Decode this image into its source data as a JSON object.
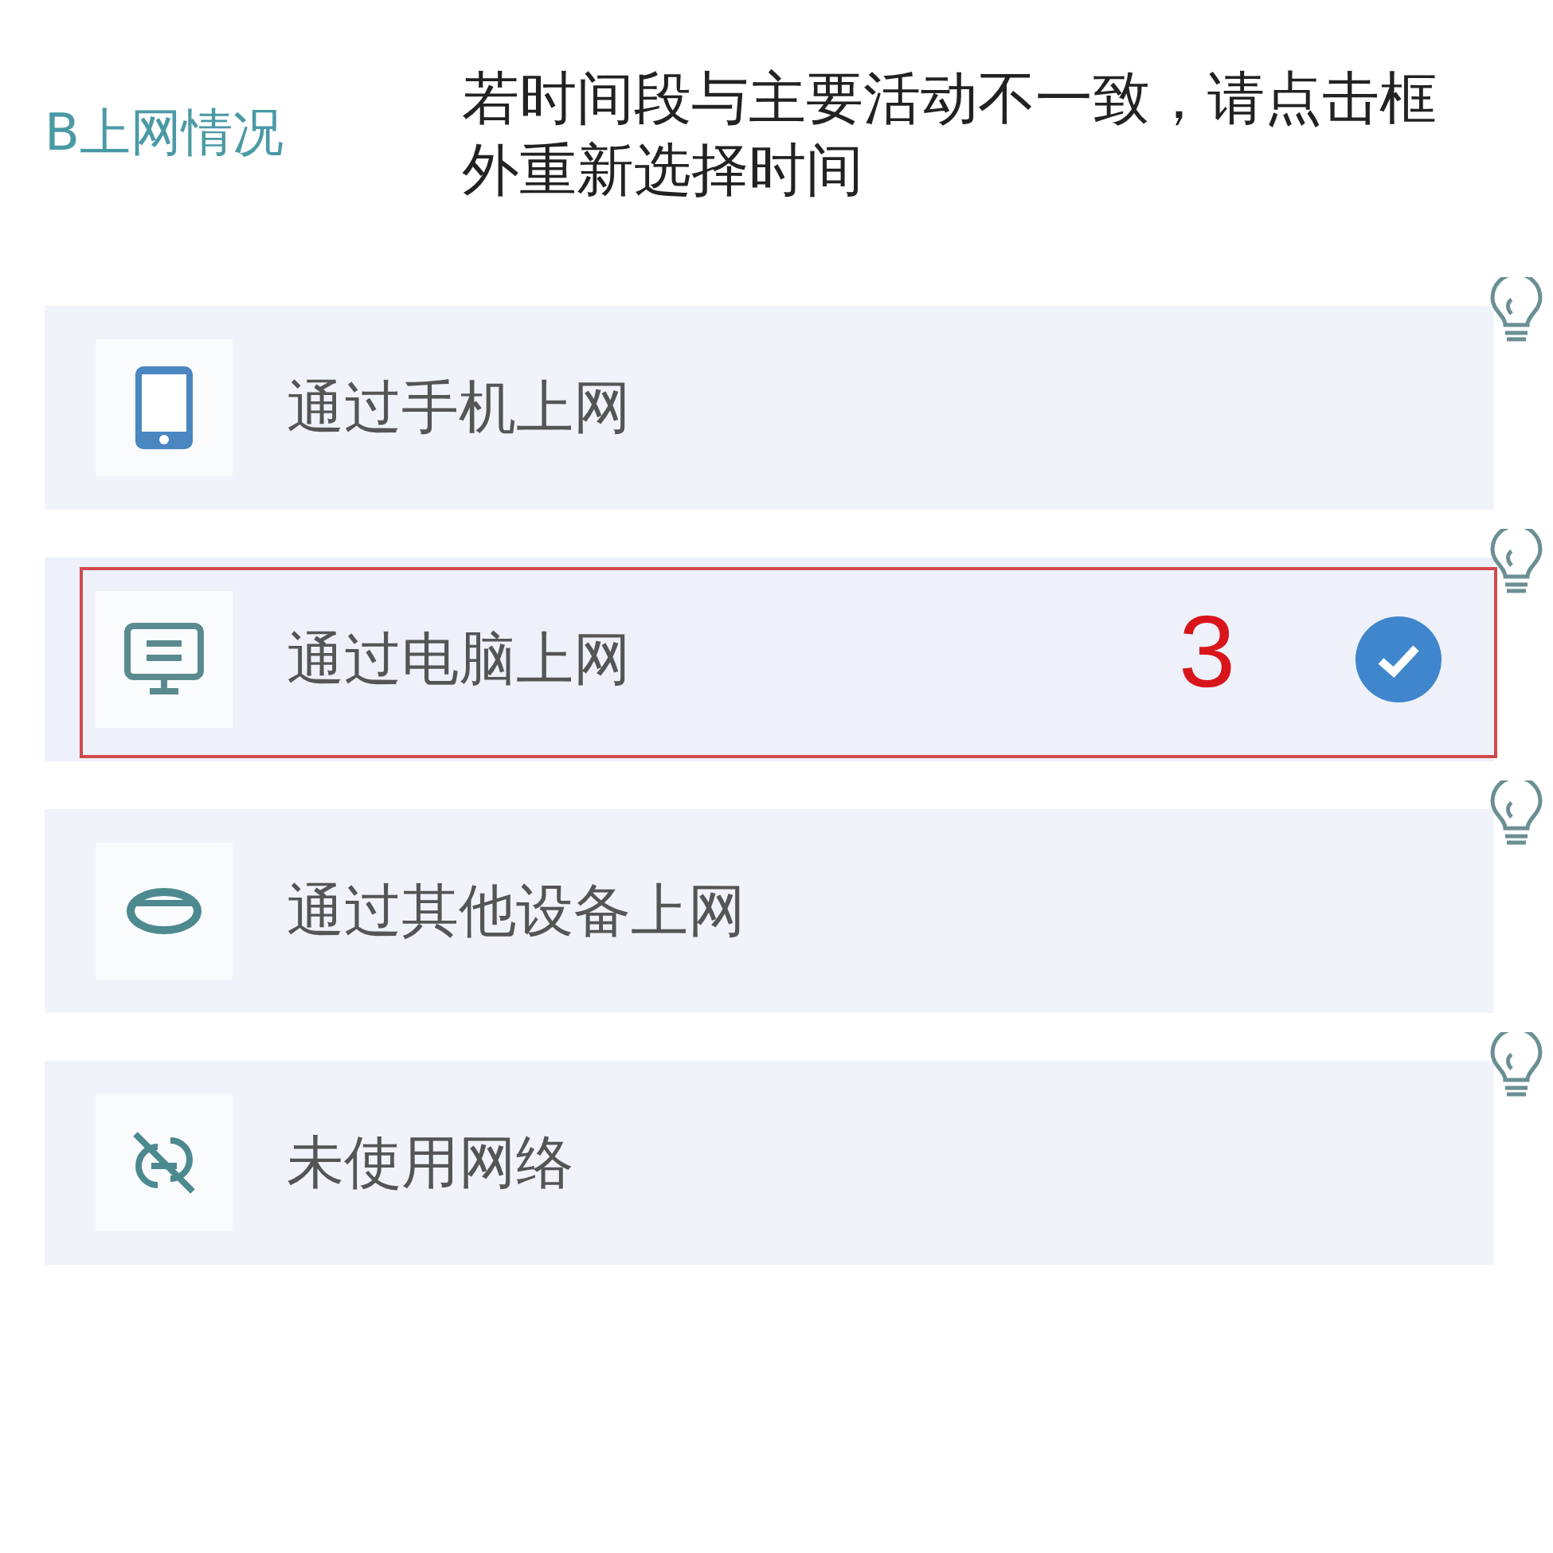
{
  "section_title": "B上网情况",
  "instruction": "若时间段与主要活动不一致，请点击框外重新选择时间",
  "options": [
    {
      "kind": "phone",
      "label": "通过手机上网",
      "selected": false
    },
    {
      "kind": "monitor",
      "label": "通过电脑上网",
      "selected": true,
      "annotation": "3"
    },
    {
      "kind": "band",
      "label": "通过其他设备上网",
      "selected": false
    },
    {
      "kind": "unlinked",
      "label": "未使用网络",
      "selected": false
    }
  ]
}
